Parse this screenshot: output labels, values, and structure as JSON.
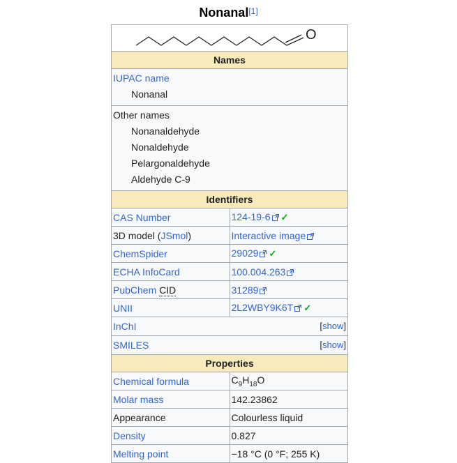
{
  "title": "Nonanal",
  "title_ref": "[1]",
  "structure_label": "O",
  "sections": {
    "names": "Names",
    "identifiers": "Identifiers",
    "properties": "Properties"
  },
  "names": {
    "iupac_label": "IUPAC name",
    "iupac_value": "Nonanal",
    "other_label": "Other names",
    "other_values": [
      "Nonanaldehyde",
      "Nonaldehyde",
      "Pelargonaldehyde",
      "Aldehyde C-9"
    ]
  },
  "identifiers": {
    "cas_label": "CAS Number",
    "cas_value": "124-19-6",
    "jsmol_label_pre": "3D model (",
    "jsmol_label_link": "JSmol",
    "jsmol_label_post": ")",
    "jsmol_value": "Interactive image",
    "chemspider_label": "ChemSpider",
    "chemspider_value": "29029",
    "echa_label": "ECHA InfoCard",
    "echa_value": "100.004.263",
    "pubchem_label_pre": "PubChem ",
    "pubchem_label_abbr": "CID",
    "pubchem_value": "31289",
    "unii_label": "UNII",
    "unii_value": "2L2WBY9K6T",
    "inchi_label": "InChI",
    "smiles_label": "SMILES",
    "show_text": "show",
    "check": "✓"
  },
  "properties": {
    "formula_label": "Chemical formula",
    "formula_c": "C",
    "formula_c_n": "9",
    "formula_h": "H",
    "formula_h_n": "18",
    "formula_o": "O",
    "molar_label": "Molar mass",
    "molar_value": "142.23862",
    "appearance_label": "Appearance",
    "appearance_value": "Colourless liquid",
    "density_label": "Density",
    "density_value": "0.827",
    "melting_label": "Melting point",
    "melting_value": "−18 °C (0 °F; 255 K)"
  },
  "colors": {
    "link": "#3366cc",
    "section_bg": "#f8eaba",
    "check": "#00af00",
    "border": "#a2a9b1"
  }
}
